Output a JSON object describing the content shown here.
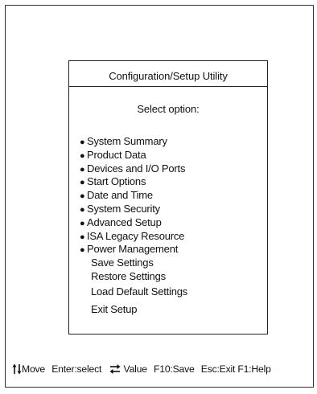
{
  "dialog": {
    "title": "Configuration/Setup Utility",
    "prompt": "Select option:"
  },
  "menu": {
    "items": [
      {
        "label": "System Summary",
        "bullet": true
      },
      {
        "label": "Product Data",
        "bullet": true
      },
      {
        "label": "Devices and I/O Ports",
        "bullet": true
      },
      {
        "label": "Start Options",
        "bullet": true
      },
      {
        "label": "Date and Time",
        "bullet": true
      },
      {
        "label": "System Security",
        "bullet": true
      },
      {
        "label": "Advanced Setup",
        "bullet": true
      },
      {
        "label": "ISA Legacy Resource",
        "bullet": true
      },
      {
        "label": "Power Management",
        "bullet": true
      },
      {
        "label": "Save Settings",
        "bullet": false
      },
      {
        "label": "Restore Settings",
        "bullet": false
      },
      {
        "label": "Load Default Settings",
        "bullet": false
      },
      {
        "label": "Exit Setup",
        "bullet": false
      }
    ]
  },
  "statusbar": {
    "move_icon": "up-down-arrows-icon",
    "move": "Move",
    "select": "Enter:select",
    "value_icon": "opposing-arrows-icon",
    "value": "Value",
    "save": "F10:Save",
    "exit": "Esc:Exit",
    "help": "F1:Help"
  }
}
